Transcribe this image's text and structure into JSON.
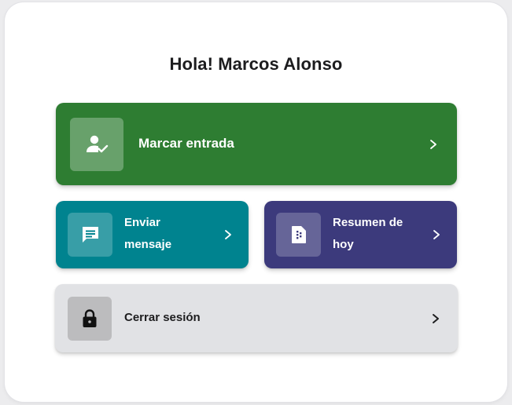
{
  "greeting": "Hola! Marcos Alonso",
  "actions": {
    "entrada": {
      "label": "Marcar entrada",
      "icon": "person-check-icon",
      "color": "#2e7d32"
    },
    "mensaje": {
      "label": "Enviar mensaje",
      "icon": "message-icon",
      "color": "#00838f"
    },
    "resumen": {
      "label": "Resumen de hoy",
      "icon": "document-icon",
      "color": "#3c3a7c"
    },
    "cerrar": {
      "label": "Cerrar sesión",
      "icon": "lock-icon",
      "color": "#e1e2e5"
    }
  }
}
